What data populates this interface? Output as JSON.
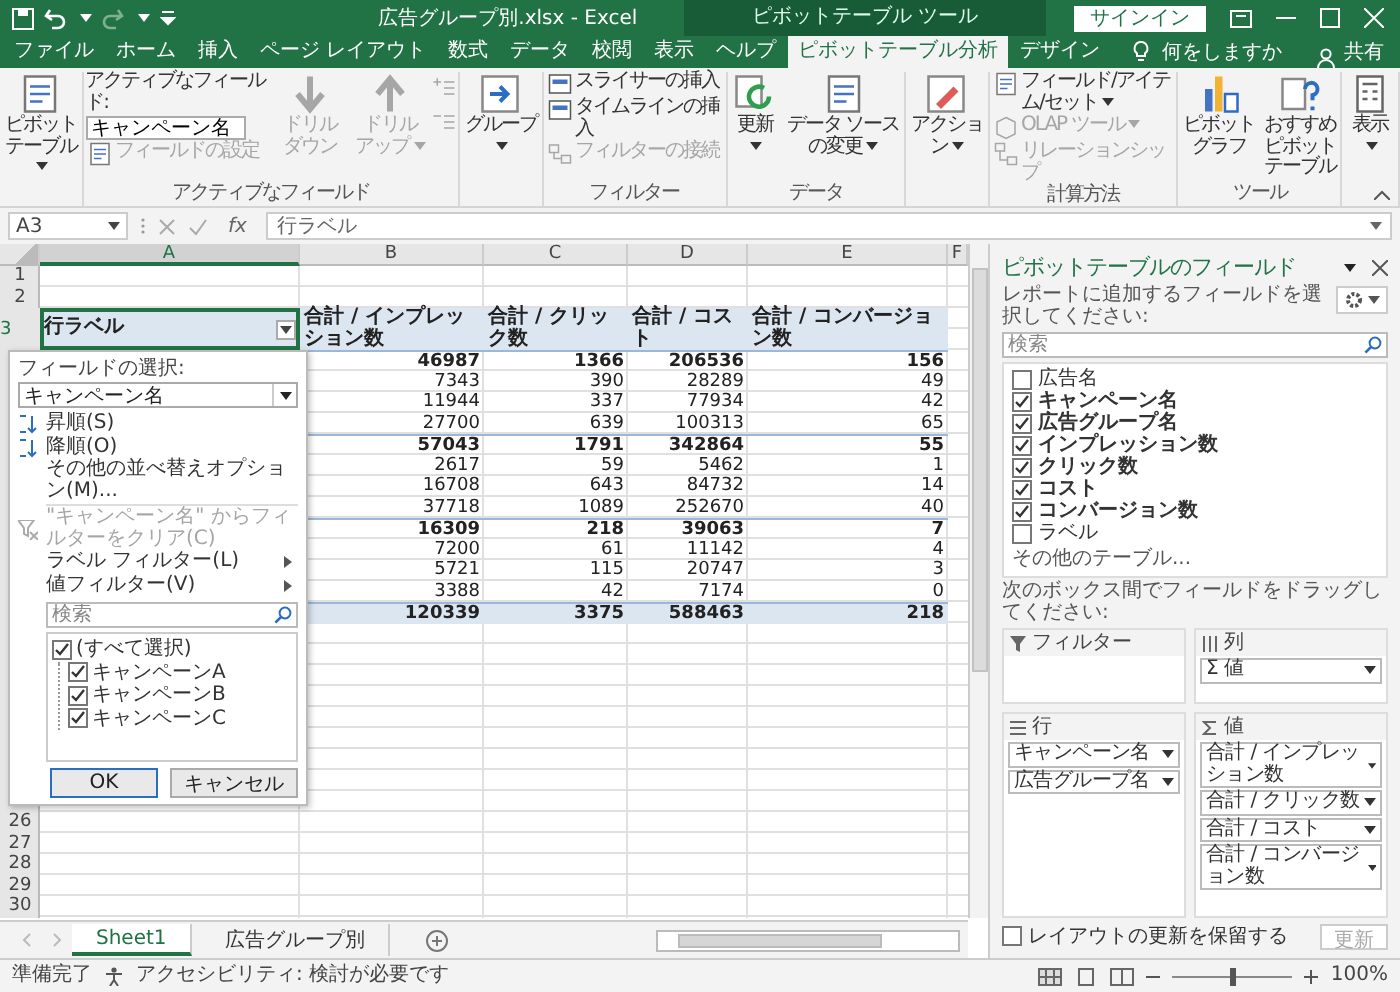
{
  "window": {
    "title": "広告グループ別.xlsx - Excel",
    "context_label": "ピボットテーブル ツール",
    "sign_in": "サインイン"
  },
  "tabs": [
    {
      "label": "ファイル",
      "selected": false
    },
    {
      "label": "ホーム",
      "selected": false
    },
    {
      "label": "挿入",
      "selected": false
    },
    {
      "label": "ページ レイアウト",
      "selected": false
    },
    {
      "label": "数式",
      "selected": false
    },
    {
      "label": "データ",
      "selected": false
    },
    {
      "label": "校閲",
      "selected": false
    },
    {
      "label": "表示",
      "selected": false
    },
    {
      "label": "ヘルプ",
      "selected": false
    },
    {
      "label": "ピボットテーブル分析",
      "selected": true
    },
    {
      "label": "デザイン",
      "selected": false
    }
  ],
  "tell_me": "何をしますか",
  "share": "共有",
  "ribbon_groups": [
    {
      "columns": [
        [
          {
            "kind": "large",
            "label": "ピボットテーブル",
            "dropdown": true,
            "disabled": false
          }
        ]
      ]
    },
    {
      "label": "アクティブなフィールド",
      "columns": [
        [
          {
            "kind": "caption",
            "label": "アクティブなフィールド:"
          },
          {
            "kind": "field",
            "value": "キャンペーン名"
          },
          {
            "kind": "small",
            "label": "フィールドの設定",
            "dropdown": false,
            "disabled": true
          }
        ],
        [
          {
            "kind": "large",
            "label": "ドリルダウン",
            "dropdown": false,
            "disabled": true
          }
        ],
        [
          {
            "kind": "large",
            "label": "ドリルアップ",
            "dropdown": true,
            "disabled": true
          }
        ],
        [
          {
            "kind": "icon",
            "disabled": true
          },
          {
            "kind": "icon",
            "disabled": true
          }
        ]
      ]
    },
    {
      "columns": [
        [
          {
            "kind": "large",
            "label": "グループ",
            "dropdown": true,
            "disabled": false
          }
        ]
      ]
    },
    {
      "label": "フィルター",
      "columns": [
        [
          {
            "kind": "small",
            "label": "スライサーの挿入",
            "dropdown": false,
            "disabled": false
          },
          {
            "kind": "small",
            "label": "タイムラインの挿入",
            "dropdown": false,
            "disabled": false
          },
          {
            "kind": "small",
            "label": "フィルターの接続",
            "dropdown": false,
            "disabled": true
          }
        ]
      ]
    },
    {
      "label": "データ",
      "columns": [
        [
          {
            "kind": "large",
            "label": "更新",
            "dropdown": true,
            "disabled": false
          }
        ],
        [
          {
            "kind": "large",
            "label": "データ ソースの変更",
            "dropdown": true,
            "disabled": false
          }
        ]
      ]
    },
    {
      "columns": [
        [
          {
            "kind": "large",
            "label": "アクション",
            "dropdown": true,
            "disabled": false
          }
        ]
      ]
    },
    {
      "label": "計算方法",
      "columns": [
        [
          {
            "kind": "small",
            "label": "フィールド/アイテム/セット",
            "dropdown": true,
            "disabled": false
          },
          {
            "kind": "small",
            "label": "OLAP ツール",
            "dropdown": true,
            "disabled": true
          },
          {
            "kind": "small",
            "label": "リレーションシップ",
            "dropdown": false,
            "disabled": true
          }
        ]
      ]
    },
    {
      "label": "ツール",
      "columns": [
        [
          {
            "kind": "large",
            "label": "ピボットグラフ",
            "dropdown": false,
            "disabled": false
          }
        ],
        [
          {
            "kind": "large",
            "label": "おすすめピボットテーブル",
            "dropdown": false,
            "disabled": false
          }
        ]
      ]
    },
    {
      "columns": [
        [
          {
            "kind": "large",
            "label": "表示",
            "dropdown": true,
            "disabled": false
          }
        ]
      ]
    }
  ],
  "formula_bar": {
    "name_box": "A3",
    "function_label": "fx",
    "formula": "行ラベル"
  },
  "sheet": {
    "columns": [
      "A",
      "B",
      "C",
      "D",
      "E",
      "F"
    ],
    "rows": [
      {
        "number": "1",
        "kind": "blank"
      },
      {
        "number": "2",
        "kind": "blank"
      },
      {
        "number": "3",
        "kind": "header",
        "label": "行ラベル",
        "values": [
          "合計 / インプレッション数",
          "合計 / クリック数",
          "合計 / コスト",
          "合計 / コンバージョン数"
        ]
      },
      {
        "kind": "subtotal",
        "values": [
          "46987",
          "1366",
          "206536",
          "156"
        ]
      },
      {
        "kind": "detail",
        "values": [
          "7343",
          "390",
          "28289",
          "49"
        ]
      },
      {
        "kind": "detail",
        "values": [
          "11944",
          "337",
          "77934",
          "42"
        ]
      },
      {
        "kind": "detail",
        "values": [
          "27700",
          "639",
          "100313",
          "65"
        ]
      },
      {
        "kind": "subtotal",
        "values": [
          "57043",
          "1791",
          "342864",
          "55"
        ]
      },
      {
        "kind": "detail",
        "values": [
          "2617",
          "59",
          "5462",
          "1"
        ]
      },
      {
        "kind": "detail",
        "values": [
          "16708",
          "643",
          "84732",
          "14"
        ]
      },
      {
        "kind": "detail",
        "values": [
          "37718",
          "1089",
          "252670",
          "40"
        ]
      },
      {
        "kind": "subtotal",
        "values": [
          "16309",
          "218",
          "39063",
          "7"
        ]
      },
      {
        "kind": "detail",
        "values": [
          "7200",
          "61",
          "11142",
          "4"
        ]
      },
      {
        "kind": "detail",
        "values": [
          "5721",
          "115",
          "20747",
          "3"
        ]
      },
      {
        "kind": "detail",
        "values": [
          "3388",
          "42",
          "7174",
          "0"
        ]
      },
      {
        "kind": "total",
        "values": [
          "120339",
          "3375",
          "588463",
          "218"
        ]
      },
      {
        "kind": "blank"
      },
      {
        "kind": "blank"
      },
      {
        "kind": "blank"
      },
      {
        "kind": "blank"
      },
      {
        "kind": "blank"
      },
      {
        "kind": "blank"
      },
      {
        "kind": "blank"
      },
      {
        "kind": "blank"
      },
      {
        "kind": "blank"
      },
      {
        "number": "26",
        "kind": "blank"
      },
      {
        "number": "27",
        "kind": "blank"
      },
      {
        "number": "28",
        "kind": "blank"
      },
      {
        "number": "29",
        "kind": "blank"
      },
      {
        "number": "30",
        "kind": "blank"
      }
    ]
  },
  "filter_menu": {
    "title": "フィールドの選択:",
    "field": "キャンペーン名",
    "items": [
      {
        "kind": "sort_asc",
        "label": "昇順(S)",
        "disabled": false
      },
      {
        "kind": "sort_desc",
        "label": "降順(O)",
        "disabled": false
      },
      {
        "kind": "plain",
        "label": "その他の並べ替えオプション(M)...",
        "disabled": false
      },
      {
        "kind": "clear",
        "label": "\"キャンペーン名\" からフィルターをクリア(C)",
        "disabled": true
      },
      {
        "kind": "submenu",
        "label": "ラベル フィルター(L)",
        "disabled": false
      },
      {
        "kind": "submenu",
        "label": "値フィルター(V)",
        "disabled": false
      }
    ],
    "search": {
      "placeholder": "検索"
    },
    "values": [
      {
        "label": "(すべて選択)",
        "checked": true,
        "children": [
          {
            "label": "キャンペーンA",
            "checked": true
          },
          {
            "label": "キャンペーンB",
            "checked": true
          },
          {
            "label": "キャンペーンC",
            "checked": true
          }
        ]
      }
    ],
    "buttons": [
      {
        "label": "OK",
        "primary": true
      },
      {
        "label": "キャンセル",
        "primary": false
      }
    ]
  },
  "pivot_panel": {
    "title": "ピボットテーブルのフィールド",
    "instruction": "レポートに追加するフィールドを選択してください:",
    "search": {
      "placeholder": "検索"
    },
    "fields": [
      {
        "label": "広告名",
        "checked": false
      },
      {
        "label": "キャンペーン名",
        "checked": true
      },
      {
        "label": "広告グループ名",
        "checked": true
      },
      {
        "label": "インプレッション数",
        "checked": true
      },
      {
        "label": "クリック数",
        "checked": true
      },
      {
        "label": "コスト",
        "checked": true
      },
      {
        "label": "コンバージョン数",
        "checked": true
      },
      {
        "label": "ラベル",
        "checked": false
      }
    ],
    "more_tables": "その他のテーブル...",
    "drag_instruction": "次のボックス間でフィールドをドラッグしてください:",
    "areas": [
      {
        "kind": "filter",
        "label": "フィルター"
      },
      {
        "kind": "columns",
        "label": "列",
        "items": [
          "Σ 値"
        ]
      },
      {
        "kind": "rows",
        "label": "行",
        "items": [
          "キャンペーン名",
          "広告グループ名"
        ]
      },
      {
        "kind": "values",
        "label": "値",
        "items": [
          "合計 / インプレッション数",
          "合計 / クリック数",
          "合計 / コスト",
          "合計 / コンバージョン数"
        ]
      }
    ],
    "defer_update": {
      "label": "レイアウトの更新を保留する",
      "checked": false
    },
    "update_button": {
      "label": "更新",
      "disabled": true
    }
  },
  "sheet_tabs": [
    {
      "label": "Sheet1",
      "selected": true
    },
    {
      "label": "広告グループ別",
      "selected": false
    }
  ],
  "status_bar": {
    "ready": "準備完了",
    "accessibility": "アクセシビリティ: 検討が必要です",
    "zoom_slider": {
      "level": 0.5
    },
    "zoom": "100%"
  }
}
